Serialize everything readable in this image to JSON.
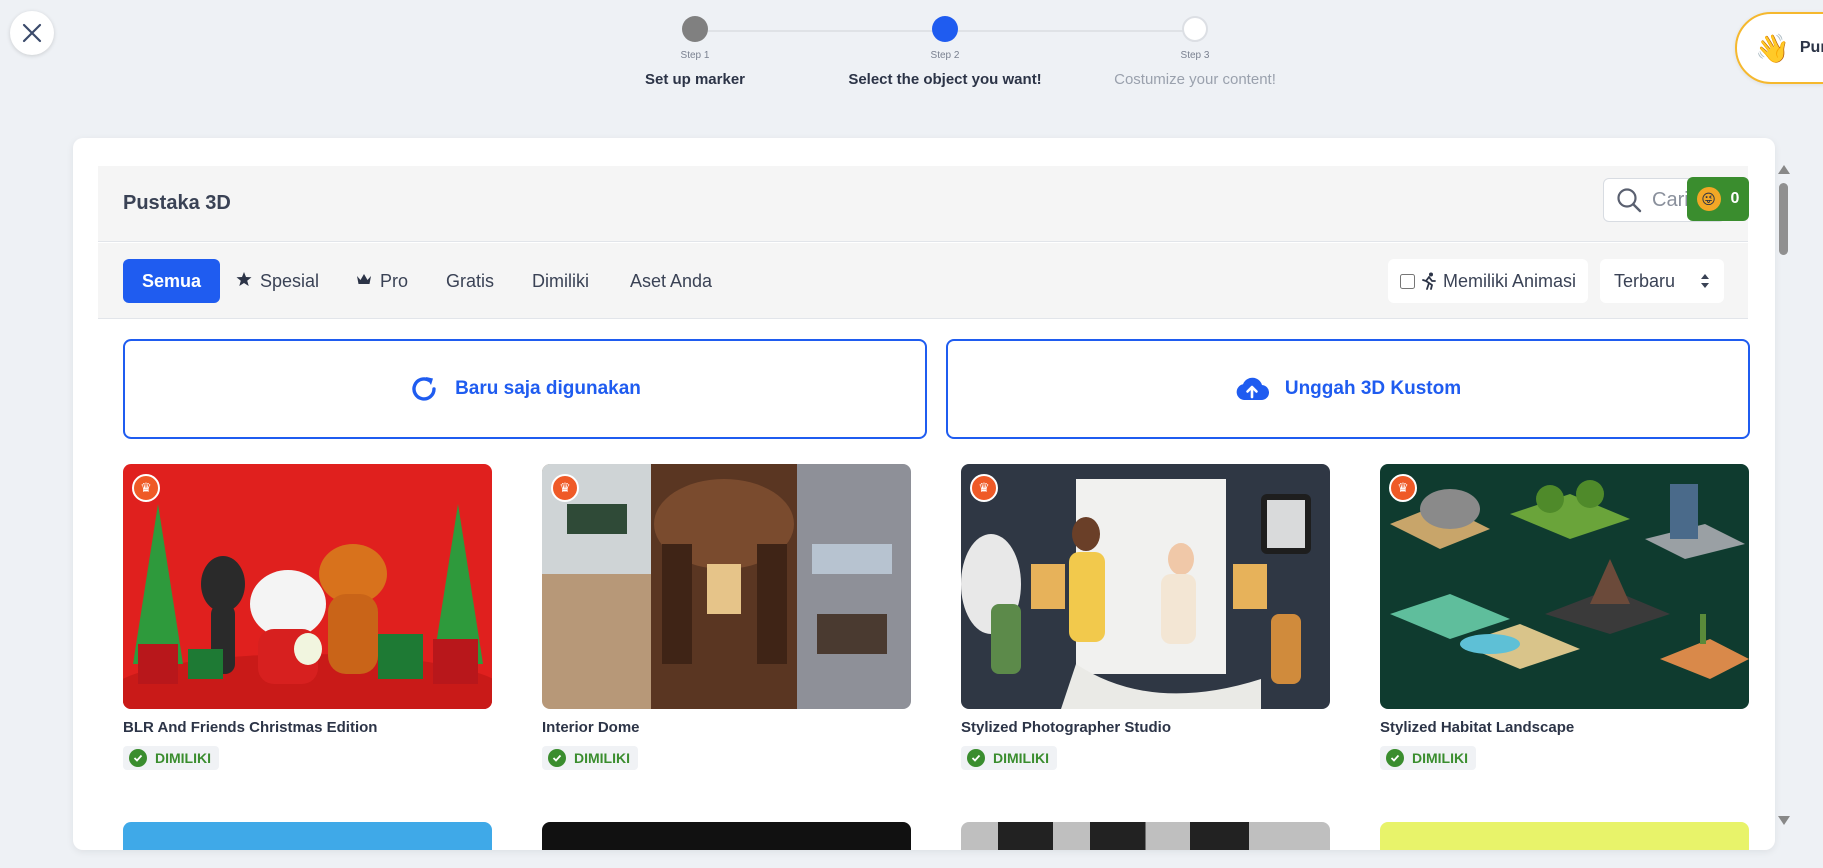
{
  "stepper": {
    "steps": [
      {
        "num": "Step 1",
        "label": "Set up marker",
        "state": "done"
      },
      {
        "num": "Step 2",
        "label": "Select the object you want!",
        "state": "active"
      },
      {
        "num": "Step 3",
        "label": "Costumize your content!",
        "state": "todo"
      }
    ]
  },
  "help": {
    "label": "Pun"
  },
  "library": {
    "title": "Pustaka 3D",
    "search_placeholder": "Cari...",
    "coins": "0",
    "tabs": [
      {
        "label": "Semua",
        "icon": ""
      },
      {
        "label": "Spesial",
        "icon": "star-icon"
      },
      {
        "label": "Pro",
        "icon": "crown-icon"
      },
      {
        "label": "Gratis",
        "icon": ""
      },
      {
        "label": "Dimiliki",
        "icon": ""
      },
      {
        "label": "Aset Anda",
        "icon": ""
      }
    ],
    "animation_filter": "Memiliki Animasi",
    "sort": "Terbaru",
    "recent_button": "Baru saja digunakan",
    "upload_button": "Unggah 3D Kustom",
    "owned_label": "DIMILIKI",
    "items": [
      {
        "name": "BLR And Friends Christmas Edition"
      },
      {
        "name": "Interior Dome"
      },
      {
        "name": "Stylized Photographer Studio"
      },
      {
        "name": "Stylized Habitat Landscape"
      }
    ]
  },
  "colors": {
    "accent": "#1f5cf0",
    "owned": "#3a8d2e",
    "crown": "#ef5a27"
  }
}
